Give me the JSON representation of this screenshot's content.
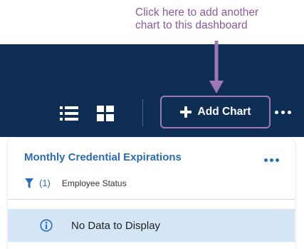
{
  "callout": {
    "line1": "Click here to add another",
    "line2": "chart to this dashboard"
  },
  "toolbar": {
    "list_view_icon": "list-icon",
    "grid_view_icon": "grid-icon",
    "add_chart_label": "Add Chart",
    "more_icon": "more-horizontal-icon"
  },
  "card": {
    "title": "Monthly Credential Expirations",
    "filter_count": "(1)",
    "filter_label": "Employee Status",
    "empty_message": "No Data to Display"
  },
  "colors": {
    "header": "#0f2e55",
    "accent": "#2c6bb5",
    "callout": "#8b5a9c",
    "highlight_border": "#9f77b2",
    "empty_bg": "#d4e6f6"
  }
}
